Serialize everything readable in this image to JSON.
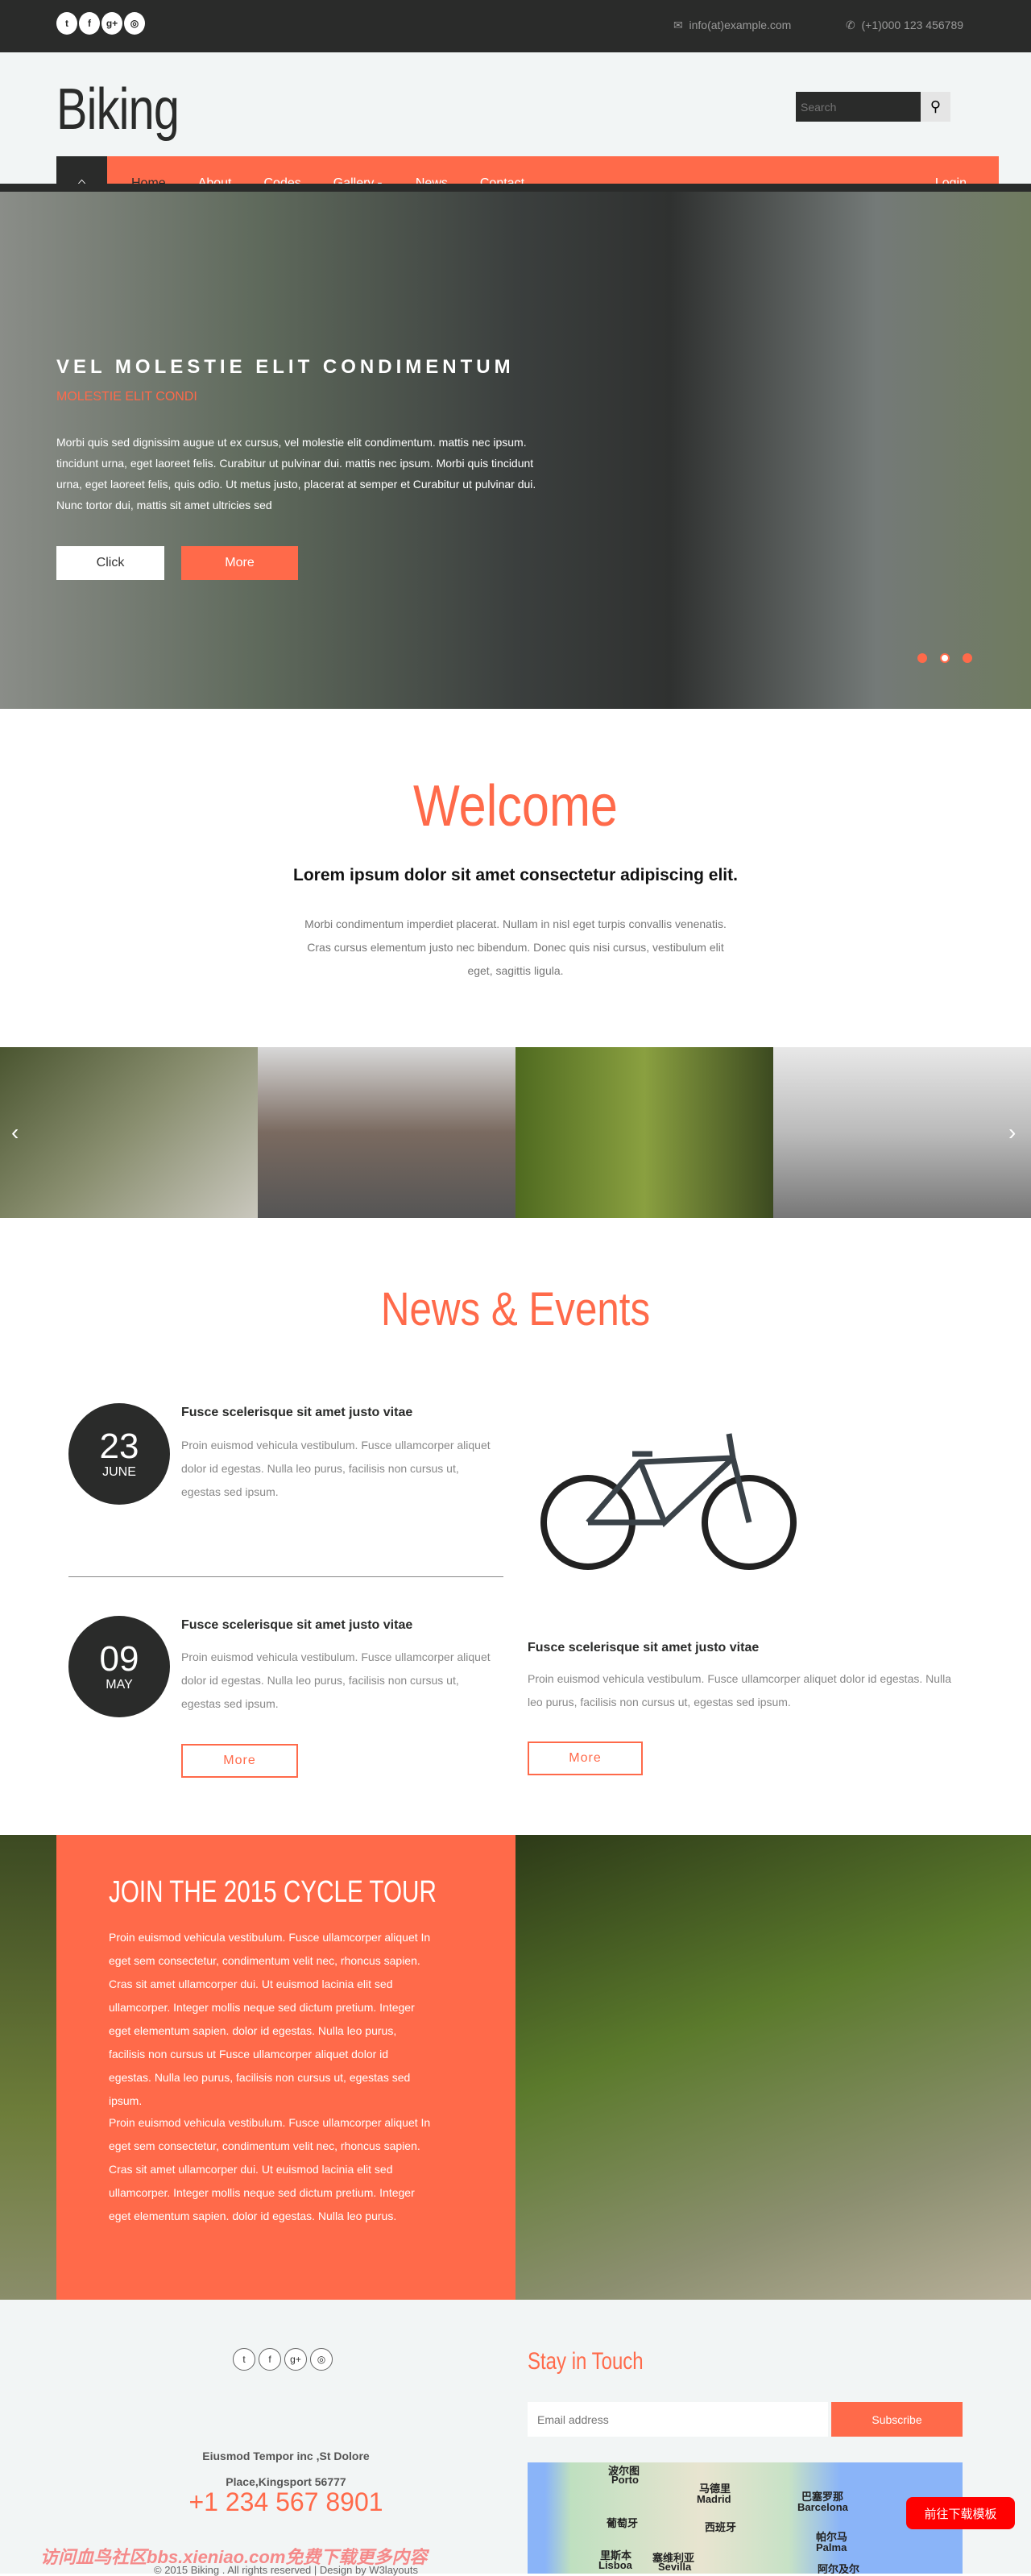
{
  "colors": {
    "accent": "#ff6a4a",
    "dark": "#2a2b2a",
    "light_bg": "#f2f5f5"
  },
  "topbar": {
    "social": [
      "twitter-icon",
      "facebook-icon",
      "google-plus-icon",
      "dribbble-icon"
    ],
    "email": "info(at)example.com",
    "phone": "(+1)000 123 456789"
  },
  "header": {
    "logo": "Biking",
    "search_placeholder": "Search"
  },
  "nav": {
    "items": [
      "Home",
      "About",
      "Codes",
      "Gallery",
      "News",
      "Contact"
    ],
    "active": "Home",
    "login": "Login"
  },
  "hero": {
    "title": "VEL MOLESTIE ELIT CONDIMENTUM",
    "subtitle": "MOLESTIE ELIT CONDI",
    "text": "Morbi quis sed dignissim augue ut ex cursus, vel molestie elit condimentum. mattis nec ipsum. tincidunt urna, eget laoreet felis. Curabitur ut pulvinar dui. mattis nec ipsum. Morbi quis tincidunt urna, eget laoreet felis, quis odio. Ut metus justo, placerat at semper et Curabitur ut pulvinar dui. Nunc tortor dui, mattis sit amet ultricies sed",
    "click": "Click",
    "more": "More",
    "slides": 3,
    "active_slide": 2
  },
  "welcome": {
    "title": "Welcome",
    "subtitle": "Lorem ipsum dolor sit amet consectetur adipiscing elit.",
    "text": "Morbi condimentum imperdiet placerat. Nullam in nisl eget turpis convallis venenatis. Cras cursus elementum justo nec bibendum. Donec quis nisi cursus, vestibulum elit eget, sagittis ligula."
  },
  "news": {
    "title": "News & Events",
    "items": [
      {
        "day": "23",
        "month": "JUNE",
        "title": "Fusce scelerisque sit amet justo vitae",
        "text": "Proin euismod vehicula vestibulum. Fusce ullamcorper aliquet dolor id egestas. Nulla leo purus, facilisis non cursus ut, egestas sed ipsum."
      },
      {
        "day": "09",
        "month": "MAY",
        "title": "Fusce scelerisque sit amet justo vitae",
        "text": "Proin euismod vehicula vestibulum. Fusce ullamcorper aliquet dolor id egestas. Nulla leo purus, facilisis non cursus ut, egestas sed ipsum.",
        "more": "More"
      }
    ],
    "feature": {
      "title": "Fusce scelerisque sit amet justo vitae",
      "text": "Proin euismod vehicula vestibulum. Fusce ullamcorper aliquet dolor id egestas. Nulla leo purus, facilisis non cursus ut, egestas sed ipsum.",
      "more": "More"
    }
  },
  "tour": {
    "title": "JOIN THE 2015 CYCLE TOUR",
    "p1": "Proin euismod vehicula vestibulum. Fusce ullamcorper aliquet In eget sem consectetur, condimentum velit nec, rhoncus sapien. Cras sit amet ullamcorper dui. Ut euismod lacinia elit sed ullamcorper. Integer mollis neque sed dictum pretium. Integer eget elementum sapien. dolor id egestas. Nulla leo purus, facilisis non cursus ut Fusce ullamcorper aliquet dolor id egestas. Nulla leo purus, facilisis non cursus ut, egestas sed ipsum.",
    "p2": "Proin euismod vehicula vestibulum. Fusce ullamcorper aliquet In eget sem consectetur, condimentum velit nec, rhoncus sapien. Cras sit amet ullamcorper dui. Ut euismod lacinia elit sed ullamcorper. Integer mollis neque sed dictum pretium. Integer eget elementum sapien. dolor id egestas. Nulla leo purus."
  },
  "footer": {
    "address1": "Eiusmod Tempor inc ,St Dolore",
    "address2": "Place,Kingsport 56777",
    "phone": "+1 234 567 8901",
    "watermark": "访问血鸟社区bbs.xieniao.com免费下载更多内容",
    "copyright": "© 2015 Biking . All rights reserved | Design by W3layouts",
    "stay": "Stay in Touch",
    "email_placeholder": "Email address",
    "subscribe": "Subscribe",
    "map_labels": [
      "波尔图",
      "Porto",
      "马德里",
      "Madrid",
      "巴塞罗那",
      "Barcelona",
      "葡萄牙",
      "西班牙",
      "帕尔马",
      "Palma",
      "里斯本",
      "Lisboa",
      "塞维利亚",
      "Sevilla",
      "阿尔及尔"
    ],
    "download": "前往下载模板"
  }
}
